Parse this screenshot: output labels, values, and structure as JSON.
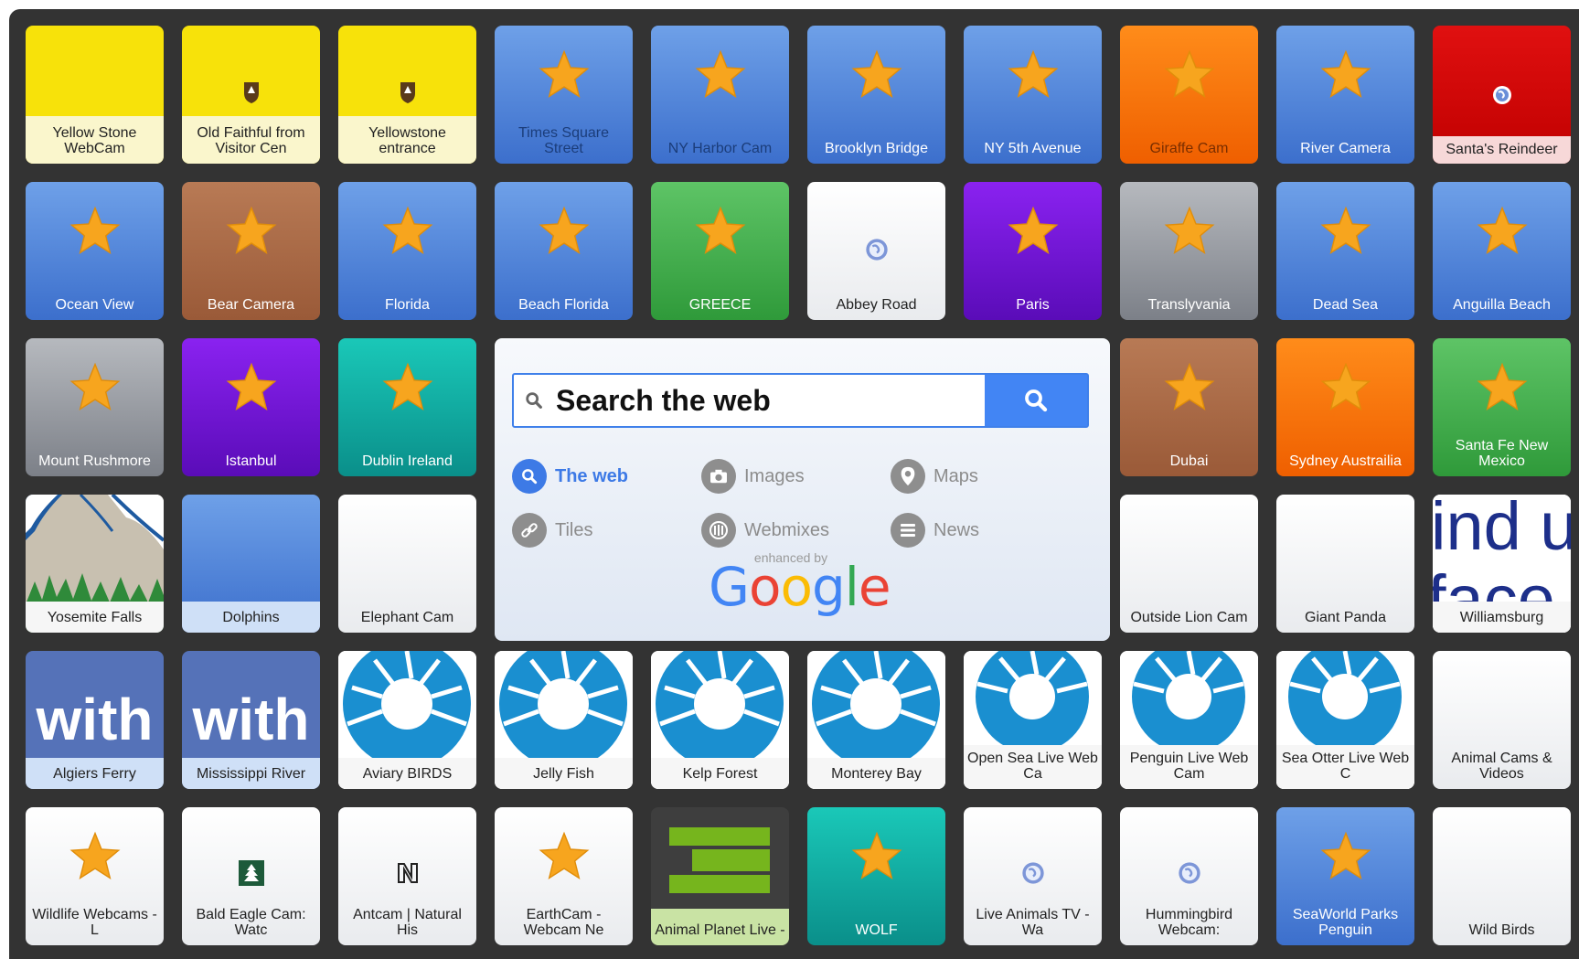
{
  "search": {
    "placeholder": "Search the web",
    "options": [
      "The web",
      "Images",
      "Maps",
      "Tiles",
      "Webmixes",
      "News"
    ],
    "active": "The web",
    "enhanced": "enhanced by",
    "logo": "Google"
  },
  "tiles": {
    "r0": [
      "Yellow Stone WebCam",
      "Old Faithful from Visitor Cen",
      "Yellowstone entrance",
      "Times Square Street",
      "NY Harbor Cam",
      "Brooklyn Bridge",
      "NY 5th Avenue",
      "Giraffe Cam",
      "River Camera",
      "Santa's Reindeer"
    ],
    "r1": [
      "Ocean View",
      "Bear Camera",
      "Florida",
      "Beach Florida",
      "GREECE",
      "Abbey Road",
      "Paris",
      "Translyvania",
      "Dead Sea",
      "Anguilla Beach"
    ],
    "r2": [
      "Mount Rushmore",
      "Istanbul",
      "Dublin Ireland",
      "Dubai",
      "Sydney Austrailia",
      "Santa Fe New Mexico"
    ],
    "r3": [
      "Yosemite Falls",
      "Dolphins",
      "Elephant Cam",
      "Outside Lion Cam",
      "Giant Panda",
      "Williamsburg"
    ],
    "r4": [
      "Algiers Ferry",
      "Mississippi River",
      "Aviary BIRDS",
      "Jelly Fish",
      "Kelp Forest",
      "Monterey Bay",
      "Open Sea Live Web Ca",
      "Penguin Live Web Cam",
      "Sea Otter Live Web C",
      "Animal Cams & Videos"
    ],
    "r5": [
      "Wildlife Webcams - L",
      "Bald Eagle Cam: Watc",
      "Antcam | Natural His",
      "EarthCam - Webcam Ne",
      "Animal Planet Live -",
      "WOLF",
      "Live Animals TV - Wa",
      "Hummingbird Webcam:",
      "SeaWorld Parks Penguin",
      "Wild Birds"
    ]
  },
  "thumb_text": {
    "with": "with",
    "ind": "ind u",
    "face": "face"
  },
  "colors": {
    "board": "#333333",
    "accent": "#4285f4",
    "star": "#f7a51e"
  }
}
